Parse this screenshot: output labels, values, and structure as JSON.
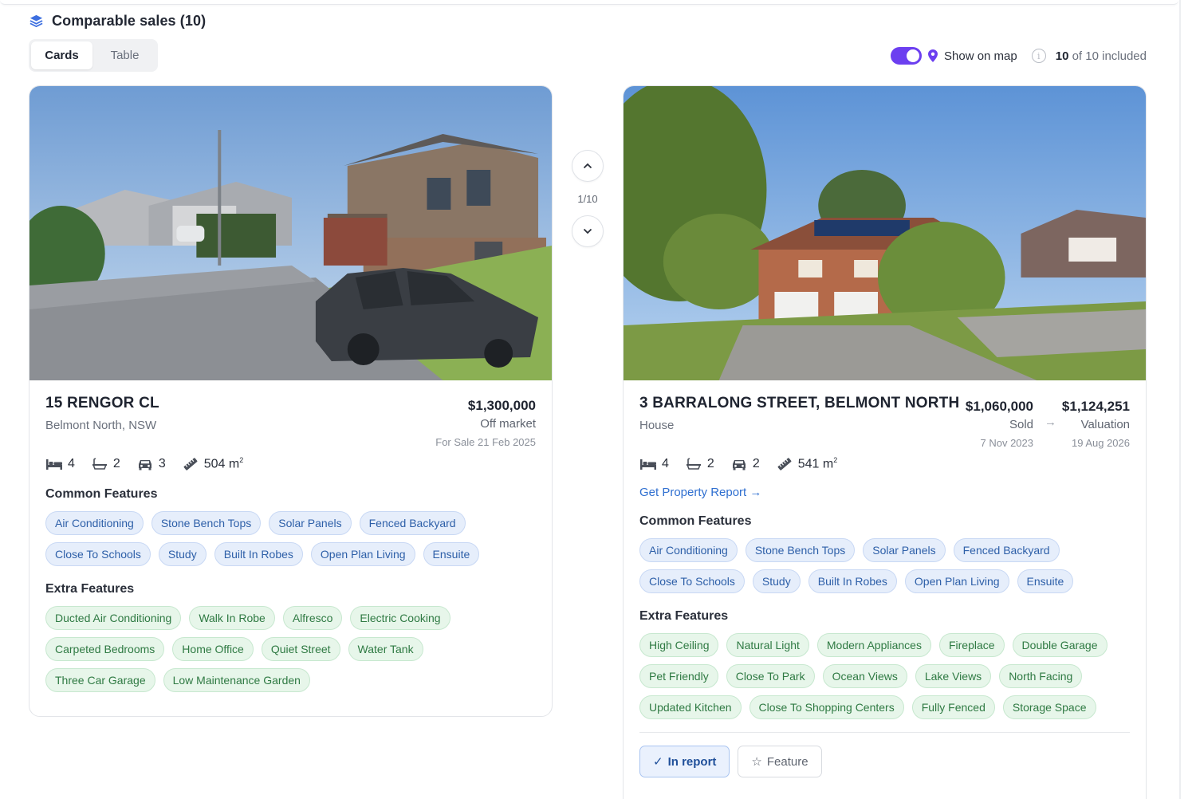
{
  "header": {
    "title": "Comparable sales (10)",
    "icon": "layers-icon"
  },
  "view_toggle": {
    "options": [
      "Cards",
      "Table"
    ],
    "active": "Cards"
  },
  "controls": {
    "show_on_map_label": "Show on map",
    "show_on_map_enabled": true,
    "included_count": "10",
    "included_rest": " of 10 included",
    "info_glyph": "i",
    "accent_color": "#6c3ff0"
  },
  "nav": {
    "counter": "1/10",
    "up_icon": "chevron-up-icon",
    "down_icon": "chevron-down-icon"
  },
  "cards": [
    {
      "address": "15 RENGOR CL",
      "subtitle": "Belmont North, NSW",
      "price": "$1,300,000",
      "status": "Off market",
      "date": "For Sale 21 Feb 2025",
      "beds": "4",
      "baths": "2",
      "cars": "3",
      "land": "504 m",
      "land_sup": "2",
      "common_title": "Common Features",
      "common": [
        "Air Conditioning",
        "Stone Bench Tops",
        "Solar Panels",
        "Fenced Backyard",
        "Close To Schools",
        "Study",
        "Built In Robes",
        "Open Plan Living",
        "Ensuite"
      ],
      "extra_title": "Extra Features",
      "extra": [
        "Ducted Air Conditioning",
        "Walk In Robe",
        "Alfresco",
        "Electric Cooking",
        "Carpeted Bedrooms",
        "Home Office",
        "Quiet Street",
        "Water Tank",
        "Three Car Garage",
        "Low Maintenance Garden"
      ]
    },
    {
      "address": "3 BARRALONG STREET, BELMONT NORTH",
      "subtitle": "House",
      "price": "$1,060,000",
      "status": "Sold",
      "date": "7 Nov 2023",
      "arrow": "→",
      "valuation": "$1,124,251",
      "valuation_label": "Valuation",
      "valuation_date": "19 Aug 2026",
      "beds": "4",
      "baths": "2",
      "cars": "2",
      "land": "541 m",
      "land_sup": "2",
      "report_link": "Get Property Report →",
      "common_title": "Common Features",
      "common": [
        "Air Conditioning",
        "Stone Bench Tops",
        "Solar Panels",
        "Fenced Backyard",
        "Close To Schools",
        "Study",
        "Built In Robes",
        "Open Plan Living",
        "Ensuite"
      ],
      "extra_title": "Extra Features",
      "extra": [
        "High Ceiling",
        "Natural Light",
        "Modern Appliances",
        "Fireplace",
        "Double Garage",
        "Pet Friendly",
        "Close To Park",
        "Ocean Views",
        "Lake Views",
        "North Facing",
        "Updated Kitchen",
        "Close To Shopping Centers",
        "Fully Fenced",
        "Storage Space"
      ],
      "in_report_label": "In report",
      "in_report_glyph": "✓",
      "feature_label": "Feature",
      "feature_glyph": "☆"
    }
  ]
}
